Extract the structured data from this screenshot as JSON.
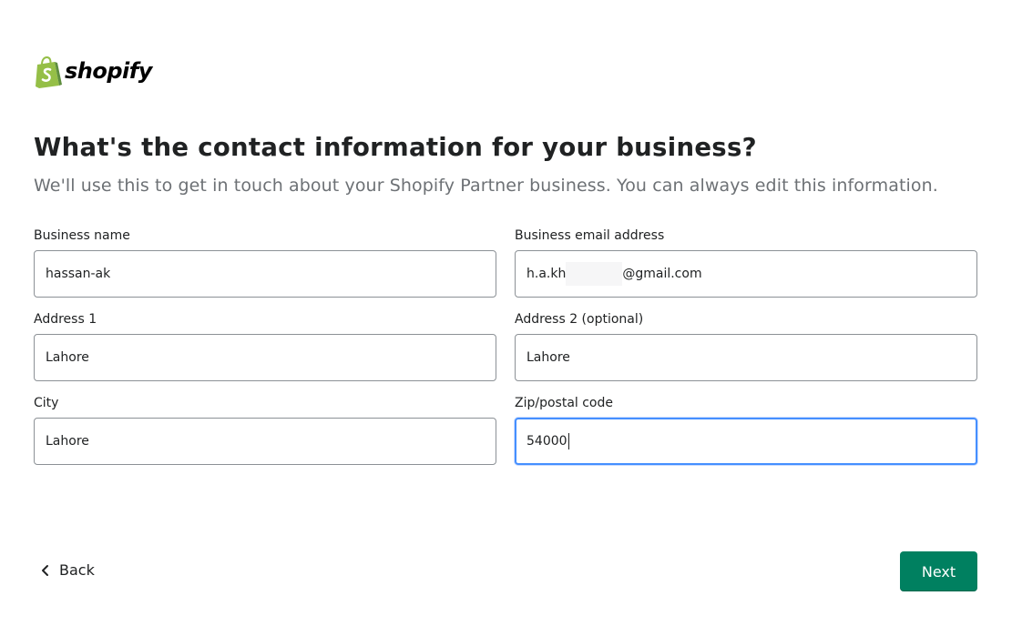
{
  "brand": {
    "name": "shopify",
    "logo_icon": "shopify-bag-icon",
    "logo_color": "#95bf47"
  },
  "heading": "What's the contact information for your business?",
  "subtitle": "We'll use this to get in touch about your Shopify Partner business. You can always edit this information.",
  "form": {
    "business_name": {
      "label": "Business name",
      "value": "hassan-ak"
    },
    "business_email": {
      "label": "Business email address",
      "value_prefix": "h.a.kh",
      "value_suffix": "@gmail.com"
    },
    "address1": {
      "label": "Address 1",
      "value": "Lahore"
    },
    "address2": {
      "label": "Address 2 (optional)",
      "value": "Lahore"
    },
    "city": {
      "label": "City",
      "value": "Lahore"
    },
    "zip": {
      "label": "Zip/postal code",
      "value": "54000",
      "focused": true
    }
  },
  "footer": {
    "back_label": "Back",
    "back_icon": "chevron-left-icon",
    "next_label": "Next"
  },
  "colors": {
    "primary": "#008060",
    "focus": "#458fff",
    "text": "#202223",
    "subdued": "#6d7175"
  }
}
